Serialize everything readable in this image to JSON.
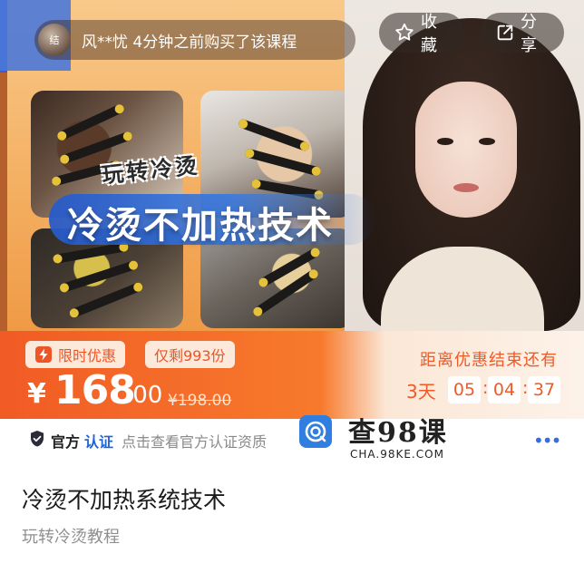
{
  "hero": {
    "toast_avatar_text": "结",
    "toast_text": "风**忧 4分钟之前购买了该课程",
    "fav_label": "收藏",
    "share_label": "分享",
    "banner_tagline": "玩转冷烫",
    "banner_title": "冷烫不加热技术"
  },
  "price": {
    "tag_limited": "限时优惠",
    "tag_stock": "仅剩993份",
    "currency": "¥",
    "integer": "168",
    "decimal": ".00",
    "original": "¥198.00",
    "countdown_label": "距离优惠结束还有",
    "days": "3天",
    "hours": "05",
    "minutes": "04",
    "seconds": "37"
  },
  "cert": {
    "official": "官方",
    "verified": "认证",
    "hint": "点击查看官方认证资质",
    "more": "•••"
  },
  "watermark": {
    "title": "查98课",
    "domain": "CHA.98KE.COM"
  },
  "course": {
    "title": "冷烫不加热系统技术",
    "subtitle": "玩转冷烫教程"
  },
  "colors": {
    "accent_orange": "#f15b25",
    "cert_blue": "#1e64d8"
  },
  "icons": [
    "star-icon",
    "share-icon",
    "lightning-icon",
    "shield-icon",
    "watermark-logo-icon",
    "more-icon"
  ]
}
